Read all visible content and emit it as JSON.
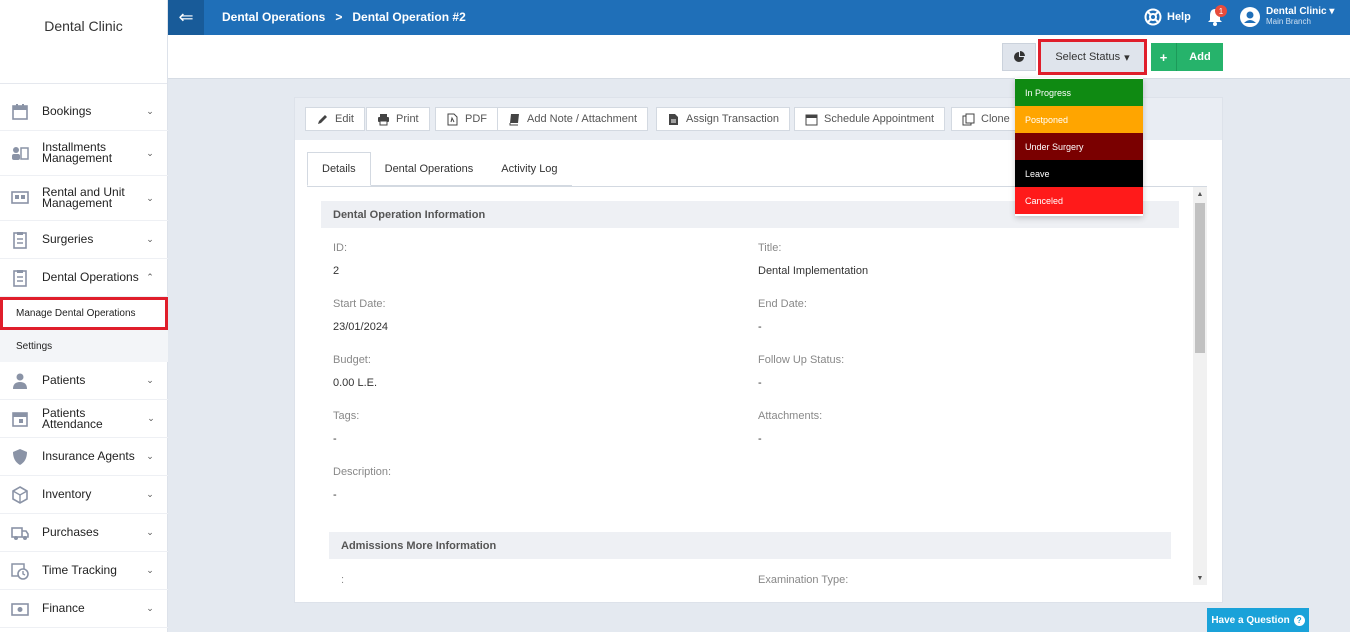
{
  "sidebar": {
    "brand": "Dental Clinic",
    "items": [
      {
        "label": "Bookings",
        "icon": "calendar-icon"
      },
      {
        "label": "Installments Management",
        "icon": "installments-icon"
      },
      {
        "label": "Rental and Unit Management",
        "icon": "rental-icon"
      },
      {
        "label": "Surgeries",
        "icon": "clipboard-icon"
      },
      {
        "label": "Dental Operations",
        "icon": "clipboard-icon",
        "expanded": true
      },
      {
        "label": "Patients",
        "icon": "patient-icon"
      },
      {
        "label": "Patients Attendance",
        "icon": "attendance-icon"
      },
      {
        "label": "Insurance Agents",
        "icon": "shield-icon"
      },
      {
        "label": "Inventory",
        "icon": "box-icon"
      },
      {
        "label": "Purchases",
        "icon": "truck-icon"
      },
      {
        "label": "Time Tracking",
        "icon": "clock-icon"
      },
      {
        "label": "Finance",
        "icon": "finance-icon"
      }
    ],
    "sub_items": [
      {
        "label": "Manage Dental Operations",
        "active": true
      },
      {
        "label": "Settings",
        "active": false
      }
    ]
  },
  "topbar": {
    "crumb_1": "Dental Operations",
    "separator": ">",
    "crumb_2": "Dental Operation #2",
    "help_label": "Help",
    "notification_count": "1",
    "user_name": "Dental Clinic",
    "user_branch": "Main Branch"
  },
  "actions": {
    "select_status_label": "Select Status",
    "add_label": "Add"
  },
  "toolbar": {
    "edit": "Edit",
    "print": "Print",
    "pdf": "PDF",
    "add_note": "Add Note / Attachment",
    "assign_transaction": "Assign Transaction",
    "schedule_appointment": "Schedule Appointment",
    "clone": "Clone"
  },
  "tabs": [
    "Details",
    "Dental Operations",
    "Activity Log"
  ],
  "details": {
    "section_title": "Dental Operation Information",
    "id_label": "ID:",
    "id_value": "2",
    "title_label": "Title:",
    "title_value": "Dental Implementation",
    "start_label": "Start Date:",
    "start_value": "23/01/2024",
    "end_label": "End Date:",
    "end_value": "-",
    "budget_label": "Budget:",
    "budget_value": "0.00 L.E.",
    "followup_label": "Follow Up Status:",
    "followup_value": "-",
    "tags_label": "Tags:",
    "tags_value": "-",
    "attachments_label": "Attachments:",
    "attachments_value": "-",
    "description_label": "Description:",
    "description_value": "-",
    "section2_title": "Admissions More Information",
    "extra_label": ":",
    "exam_label": "Examination Type:"
  },
  "status_options": [
    {
      "label": "In Progress",
      "color": "#0f8a12"
    },
    {
      "label": "Postponed",
      "color": "#ffa500"
    },
    {
      "label": "Under Surgery",
      "color": "#7a0000"
    },
    {
      "label": "Leave",
      "color": "#000000"
    },
    {
      "label": "Canceled",
      "color": "#ff1a1a"
    }
  ],
  "help_button": "Have a Question",
  "colors": {
    "primary": "#1f6fb8",
    "add_green": "#26b36b",
    "highlight_red": "#e01e2b"
  }
}
